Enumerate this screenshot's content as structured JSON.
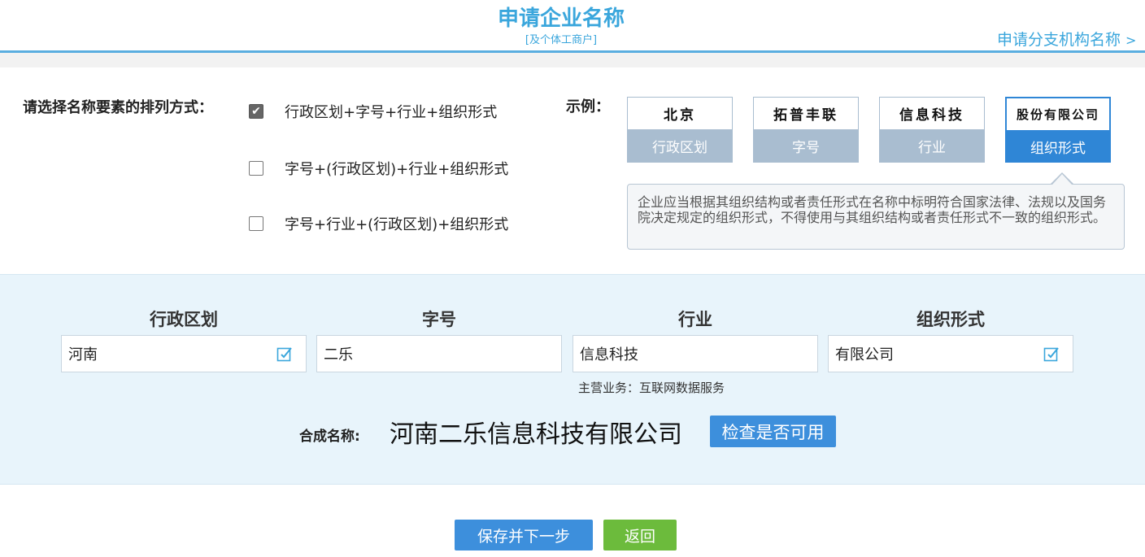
{
  "header": {
    "title": "申请企业名称",
    "subtitle": "[及个体工商户]",
    "branch_link": "申请分支机构名称",
    "branch_arrow": ">"
  },
  "arrangement": {
    "label": "请选择名称要素的排列方式：",
    "options": [
      {
        "label": "行政区划+字号+行业+组织形式",
        "checked": true
      },
      {
        "label": "字号+(行政区划)+行业+组织形式",
        "checked": false
      },
      {
        "label": "字号+行业+(行政区划)+组织形式",
        "checked": false
      }
    ]
  },
  "example": {
    "label": "示例：",
    "cards": [
      {
        "text": "北京",
        "caption": "行政区划",
        "active": false
      },
      {
        "text": "拓普丰联",
        "caption": "字号",
        "active": false
      },
      {
        "text": "信息科技",
        "caption": "行业",
        "active": false
      },
      {
        "text": "股份有限公司",
        "caption": "组织形式",
        "active": true
      }
    ],
    "tooltip": "企业应当根据其组织结构或者责任形式在名称中标明符合国家法律、法规以及国务院决定规定的组织形式，不得使用与其组织结构或者责任形式不一致的组织形式。"
  },
  "form": {
    "columns": [
      {
        "header": "行政区划",
        "value": "河南",
        "has_edit_icon": true
      },
      {
        "header": "字号",
        "value": "二乐",
        "has_edit_icon": false
      },
      {
        "header": "行业",
        "value": "信息科技",
        "has_edit_icon": false
      },
      {
        "header": "组织形式",
        "value": "有限公司",
        "has_edit_icon": true
      }
    ],
    "main_business": "主营业务：互联网数据服务",
    "synth_label": "合成名称:",
    "synth_name": "河南二乐信息科技有限公司",
    "check_button": "检查是否可用"
  },
  "actions": {
    "save_next": "保存并下一步",
    "back": "返回"
  },
  "colors": {
    "accent": "#3aa6dc",
    "primary_button": "#3d8fdc",
    "back_button": "#6cbb3c",
    "card_inactive": "#a9bdd0",
    "panel_bg": "#e8f4fb"
  },
  "icons": [
    "check-icon",
    "edit-icon",
    "chevron-right-icon"
  ]
}
